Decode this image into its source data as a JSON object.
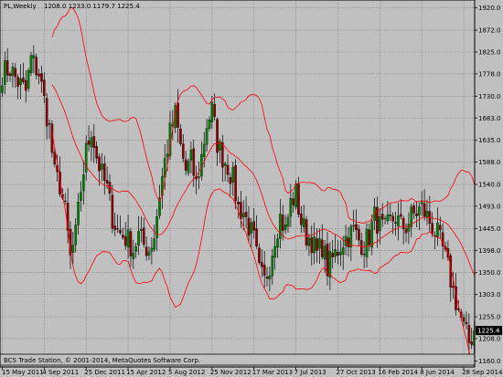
{
  "header": {
    "symbol_timeframe": "PL,Weekly",
    "ohlc_text": "1208.0 1233.0 1179.7 1225.4"
  },
  "footer": {
    "copyright": "BCS Trade Station, © 2001-2014, MetaQuotes Software Corp."
  },
  "colors": {
    "background": "#c0c0c0",
    "candle_up_body": "#008000",
    "candle_down_body": "#8b0000",
    "wick": "#000000",
    "bollinger": "#ff0000",
    "grid": "#7f7f7f",
    "last_price_box": "#000000"
  },
  "chart_data": {
    "type": "candlestick",
    "instrument": "PL",
    "timeframe": "Weekly",
    "y_ticks": [
      1920.0,
      1872.0,
      1825.0,
      1778.0,
      1730.0,
      1683.0,
      1635.0,
      1588.0,
      1540.0,
      1493.0,
      1445.0,
      1398.0,
      1350.0,
      1303.0,
      1255.0,
      1208.0,
      1160.0
    ],
    "ylim": [
      1147,
      1937
    ],
    "x_ticks": [
      {
        "label": "15 May 2011",
        "index": 0
      },
      {
        "label": "4 Sep 2011",
        "index": 16
      },
      {
        "label": "25 Dec 2011",
        "index": 32
      },
      {
        "label": "15 Apr 2012",
        "index": 48
      },
      {
        "label": "5 Aug 2012",
        "index": 64
      },
      {
        "label": "25 Nov 2012",
        "index": 80
      },
      {
        "label": "17 Mar 2013",
        "index": 96
      },
      {
        "label": "7 Jul 2013",
        "index": 112
      },
      {
        "label": "27 Oct 2013",
        "index": 128
      },
      {
        "label": "16 Feb 2014",
        "index": 144
      },
      {
        "label": "8 Jun 2014",
        "index": 160
      },
      {
        "label": "28 Sep 2014",
        "index": 176
      }
    ],
    "last_price": 1225.4,
    "indicator": "Bollinger Bands (upper / middle / lower)",
    "close_anchors": [
      [
        0,
        1780
      ],
      [
        3,
        1790
      ],
      [
        6,
        1760
      ],
      [
        9,
        1740
      ],
      [
        11,
        1810
      ],
      [
        14,
        1780
      ],
      [
        16,
        1720
      ],
      [
        18,
        1660
      ],
      [
        20,
        1560
      ],
      [
        22,
        1540
      ],
      [
        24,
        1480
      ],
      [
        26,
        1380
      ],
      [
        28,
        1430
      ],
      [
        30,
        1530
      ],
      [
        32,
        1610
      ],
      [
        34,
        1660
      ],
      [
        36,
        1600
      ],
      [
        38,
        1560
      ],
      [
        40,
        1530
      ],
      [
        42,
        1470
      ],
      [
        44,
        1440
      ],
      [
        46,
        1430
      ],
      [
        48,
        1420
      ],
      [
        50,
        1400
      ],
      [
        52,
        1430
      ],
      [
        54,
        1410
      ],
      [
        56,
        1400
      ],
      [
        58,
        1430
      ],
      [
        60,
        1520
      ],
      [
        62,
        1590
      ],
      [
        64,
        1650
      ],
      [
        66,
        1690
      ],
      [
        68,
        1620
      ],
      [
        70,
        1570
      ],
      [
        72,
        1590
      ],
      [
        74,
        1540
      ],
      [
        76,
        1600
      ],
      [
        78,
        1670
      ],
      [
        80,
        1700
      ],
      [
        82,
        1630
      ],
      [
        84,
        1600
      ],
      [
        86,
        1580
      ],
      [
        88,
        1550
      ],
      [
        90,
        1490
      ],
      [
        92,
        1480
      ],
      [
        94,
        1450
      ],
      [
        96,
        1420
      ],
      [
        98,
        1350
      ],
      [
        100,
        1330
      ],
      [
        102,
        1370
      ],
      [
        104,
        1430
      ],
      [
        106,
        1470
      ],
      [
        108,
        1440
      ],
      [
        110,
        1500
      ],
      [
        112,
        1520
      ],
      [
        114,
        1460
      ],
      [
        116,
        1430
      ],
      [
        118,
        1420
      ],
      [
        120,
        1390
      ],
      [
        122,
        1410
      ],
      [
        124,
        1360
      ],
      [
        126,
        1380
      ],
      [
        128,
        1400
      ],
      [
        130,
        1420
      ],
      [
        132,
        1430
      ],
      [
        134,
        1440
      ],
      [
        136,
        1420
      ],
      [
        138,
        1410
      ],
      [
        140,
        1430
      ],
      [
        142,
        1470
      ],
      [
        144,
        1450
      ],
      [
        146,
        1440
      ],
      [
        148,
        1460
      ],
      [
        150,
        1470
      ],
      [
        152,
        1450
      ],
      [
        154,
        1450
      ],
      [
        156,
        1470
      ],
      [
        158,
        1480
      ],
      [
        160,
        1490
      ],
      [
        162,
        1470
      ],
      [
        164,
        1450
      ],
      [
        166,
        1430
      ],
      [
        168,
        1400
      ],
      [
        170,
        1360
      ],
      [
        172,
        1310
      ],
      [
        174,
        1270
      ],
      [
        176,
        1230
      ],
      [
        178,
        1200
      ],
      [
        180,
        1225
      ]
    ]
  }
}
